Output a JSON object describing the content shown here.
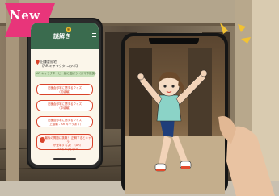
{
  "badge": {
    "label": "New",
    "color": "#e8357a"
  },
  "left_phone": {
    "app_logo": "謎解き",
    "app_badge": "新",
    "area_label": "旧鎌倉邸宅",
    "area_sublabel": "【AR キャラクタ-コラボ】",
    "info_bar": "AR キャラクターと一緒に遊ぼう（スマホ推奨）",
    "quiz_buttons": [
      {
        "line1": "旧鎌倉邸宅に関するクイズ",
        "line2": "（初級編）"
      },
      {
        "line1": "旧鎌倉邸宅に関するクイズ",
        "line2": "（中級編）"
      },
      {
        "line1": "旧鎌倉邸宅に関するクイズ",
        "line2": "（上級編 - AR キャラあり）"
      },
      {
        "line1": "最後の問題に挑戦！ 正解するとキャラ",
        "line2": "が登場するよ！（AR）",
        "line3": "ARキャラクター"
      }
    ],
    "header_color": "#3a6b4e",
    "accent_color": "#d9432b"
  },
  "right_phone": {
    "ar_character": "girl-character-waving"
  },
  "icons": [
    "menu-icon",
    "pin-icon",
    "warning-icon",
    "sparkle-icon"
  ]
}
